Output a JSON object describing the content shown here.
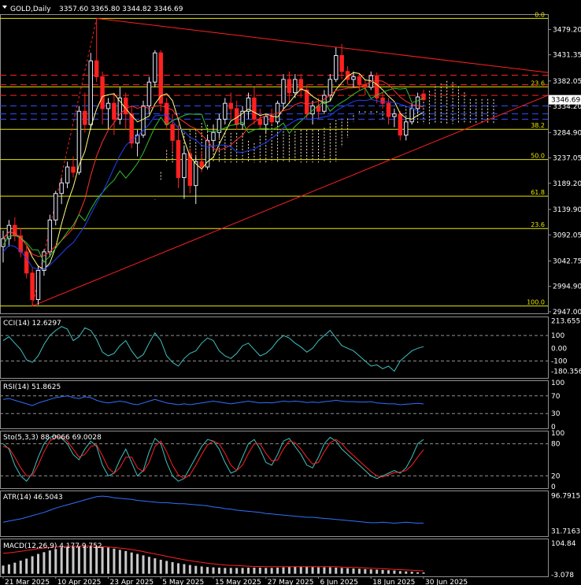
{
  "header": {
    "symbol": "GOLD,Daily",
    "ohlc": "3357.60 3365.80 3344.82 3346.69"
  },
  "colors": {
    "background": "#000000",
    "bull_candle": "#e8e8ff",
    "bear_candle": "#ff2020",
    "grid": "#808080",
    "fib": "#e8e800",
    "trend": "#ff2020",
    "ichimoku_cloud": "#ffe8c0",
    "cci": "#40c0c0",
    "rsi": "#3070ff",
    "stoch_main": "#40c0c0",
    "stoch_signal": "#ff2020",
    "atr": "#3070ff",
    "macd_hist": "#c8c8c8",
    "macd_signal": "#ff2020"
  },
  "chart_data": [
    {
      "id": "price",
      "type": "candlestick",
      "ylim": [
        2947.0,
        3505.0
      ],
      "y_ticks": [
        "3479.20",
        "3431.35",
        "3382.05",
        "3334.20",
        "3284.90",
        "3237.05",
        "3189.20",
        "3139.90",
        "3092.05",
        "3042.75",
        "2994.90",
        "2947.00"
      ],
      "current_price": "3346.69",
      "fib_levels": [
        {
          "label": "0.0",
          "value": 3500.0
        },
        {
          "label": "23.6",
          "value": 3371.0
        },
        {
          "label": "38.2",
          "value": 3291.0
        },
        {
          "label": "50.0",
          "value": 3234.0
        },
        {
          "label": "61.8",
          "value": 3165.0
        },
        {
          "label": "23.6",
          "value": 3104.0
        },
        {
          "label": "100.0",
          "value": 2958.0
        }
      ],
      "dashed_levels_red": [
        3393.0,
        3375.0,
        3355.0
      ],
      "dashed_levels_blue": [
        3335.0,
        3320.0,
        3310.0
      ],
      "candles": [
        {
          "o": 3070,
          "h": 3100,
          "l": 3040,
          "c": 3085
        },
        {
          "o": 3085,
          "h": 3120,
          "l": 3070,
          "c": 3110
        },
        {
          "o": 3110,
          "h": 3125,
          "l": 3080,
          "c": 3090
        },
        {
          "o": 3090,
          "h": 3105,
          "l": 3050,
          "c": 3060
        },
        {
          "o": 3060,
          "h": 3070,
          "l": 3010,
          "c": 3020
        },
        {
          "o": 3020,
          "h": 3030,
          "l": 2957,
          "c": 2970
        },
        {
          "o": 2970,
          "h": 3035,
          "l": 2960,
          "c": 3025
        },
        {
          "o": 3025,
          "h": 3065,
          "l": 3015,
          "c": 3060
        },
        {
          "o": 3060,
          "h": 3130,
          "l": 3050,
          "c": 3120
        },
        {
          "o": 3120,
          "h": 3175,
          "l": 3110,
          "c": 3170
        },
        {
          "o": 3170,
          "h": 3200,
          "l": 3150,
          "c": 3190
        },
        {
          "o": 3190,
          "h": 3230,
          "l": 3180,
          "c": 3220
        },
        {
          "o": 3220,
          "h": 3240,
          "l": 3200,
          "c": 3210
        },
        {
          "o": 3210,
          "h": 3335,
          "l": 3205,
          "c": 3325
        },
        {
          "o": 3325,
          "h": 3360,
          "l": 3285,
          "c": 3300
        },
        {
          "o": 3300,
          "h": 3435,
          "l": 3290,
          "c": 3420
        },
        {
          "o": 3420,
          "h": 3500,
          "l": 3380,
          "c": 3390
        },
        {
          "o": 3390,
          "h": 3400,
          "l": 3300,
          "c": 3330
        },
        {
          "o": 3330,
          "h": 3350,
          "l": 3290,
          "c": 3340
        },
        {
          "o": 3340,
          "h": 3360,
          "l": 3280,
          "c": 3310
        },
        {
          "o": 3310,
          "h": 3370,
          "l": 3300,
          "c": 3350
        },
        {
          "o": 3350,
          "h": 3360,
          "l": 3290,
          "c": 3320
        },
        {
          "o": 3320,
          "h": 3335,
          "l": 3255,
          "c": 3265
        },
        {
          "o": 3265,
          "h": 3290,
          "l": 3240,
          "c": 3280
        },
        {
          "o": 3280,
          "h": 3345,
          "l": 3275,
          "c": 3335
        },
        {
          "o": 3335,
          "h": 3390,
          "l": 3320,
          "c": 3380
        },
        {
          "o": 3380,
          "h": 3440,
          "l": 3370,
          "c": 3435
        },
        {
          "o": 3435,
          "h": 3440,
          "l": 3325,
          "c": 3340
        },
        {
          "o": 3340,
          "h": 3350,
          "l": 3290,
          "c": 3300
        },
        {
          "o": 3300,
          "h": 3320,
          "l": 3250,
          "c": 3270
        },
        {
          "o": 3270,
          "h": 3300,
          "l": 3180,
          "c": 3200
        },
        {
          "o": 3200,
          "h": 3260,
          "l": 3160,
          "c": 3245
        },
        {
          "o": 3245,
          "h": 3255,
          "l": 3170,
          "c": 3185
        },
        {
          "o": 3185,
          "h": 3240,
          "l": 3150,
          "c": 3230
        },
        {
          "o": 3230,
          "h": 3250,
          "l": 3210,
          "c": 3220
        },
        {
          "o": 3220,
          "h": 3280,
          "l": 3215,
          "c": 3270
        },
        {
          "o": 3270,
          "h": 3300,
          "l": 3250,
          "c": 3285
        },
        {
          "o": 3285,
          "h": 3320,
          "l": 3275,
          "c": 3310
        },
        {
          "o": 3310,
          "h": 3350,
          "l": 3300,
          "c": 3340
        },
        {
          "o": 3340,
          "h": 3360,
          "l": 3310,
          "c": 3330
        },
        {
          "o": 3330,
          "h": 3345,
          "l": 3290,
          "c": 3300
        },
        {
          "o": 3300,
          "h": 3335,
          "l": 3290,
          "c": 3325
        },
        {
          "o": 3325,
          "h": 3360,
          "l": 3310,
          "c": 3350
        },
        {
          "o": 3350,
          "h": 3370,
          "l": 3300,
          "c": 3310
        },
        {
          "o": 3310,
          "h": 3330,
          "l": 3290,
          "c": 3300
        },
        {
          "o": 3300,
          "h": 3320,
          "l": 3285,
          "c": 3315
        },
        {
          "o": 3315,
          "h": 3330,
          "l": 3300,
          "c": 3305
        },
        {
          "o": 3305,
          "h": 3345,
          "l": 3300,
          "c": 3340
        },
        {
          "o": 3340,
          "h": 3395,
          "l": 3330,
          "c": 3385
        },
        {
          "o": 3385,
          "h": 3400,
          "l": 3340,
          "c": 3360
        },
        {
          "o": 3360,
          "h": 3395,
          "l": 3350,
          "c": 3385
        },
        {
          "o": 3385,
          "h": 3395,
          "l": 3350,
          "c": 3365
        },
        {
          "o": 3365,
          "h": 3375,
          "l": 3310,
          "c": 3320
        },
        {
          "o": 3320,
          "h": 3345,
          "l": 3300,
          "c": 3335
        },
        {
          "o": 3335,
          "h": 3350,
          "l": 3310,
          "c": 3325
        },
        {
          "o": 3325,
          "h": 3365,
          "l": 3320,
          "c": 3355
        },
        {
          "o": 3355,
          "h": 3395,
          "l": 3345,
          "c": 3385
        },
        {
          "o": 3385,
          "h": 3445,
          "l": 3380,
          "c": 3430
        },
        {
          "o": 3430,
          "h": 3452,
          "l": 3385,
          "c": 3400
        },
        {
          "o": 3400,
          "h": 3410,
          "l": 3375,
          "c": 3385
        },
        {
          "o": 3385,
          "h": 3400,
          "l": 3370,
          "c": 3390
        },
        {
          "o": 3390,
          "h": 3395,
          "l": 3365,
          "c": 3375
        },
        {
          "o": 3375,
          "h": 3385,
          "l": 3355,
          "c": 3370
        },
        {
          "o": 3370,
          "h": 3400,
          "l": 3365,
          "c": 3392
        },
        {
          "o": 3392,
          "h": 3398,
          "l": 3340,
          "c": 3350
        },
        {
          "o": 3350,
          "h": 3360,
          "l": 3330,
          "c": 3340
        },
        {
          "o": 3340,
          "h": 3350,
          "l": 3300,
          "c": 3315
        },
        {
          "o": 3315,
          "h": 3330,
          "l": 3295,
          "c": 3320
        },
        {
          "o": 3320,
          "h": 3325,
          "l": 3270,
          "c": 3280
        },
        {
          "o": 3280,
          "h": 3310,
          "l": 3270,
          "c": 3305
        },
        {
          "o": 3305,
          "h": 3340,
          "l": 3300,
          "c": 3330
        },
        {
          "o": 3330,
          "h": 3360,
          "l": 3320,
          "c": 3352
        },
        {
          "o": 3357.6,
          "h": 3365.8,
          "l": 3344.82,
          "c": 3346.69
        }
      ]
    },
    {
      "id": "cci",
      "type": "line",
      "label": "CCI(14) 12.6297",
      "ylim": [
        -220,
        230
      ],
      "y_ticks": [
        "213.655",
        "100",
        "0.00",
        "-100",
        "-180.3566"
      ],
      "levels": [
        100,
        -100
      ],
      "values": [
        60,
        90,
        40,
        -10,
        -90,
        -110,
        -60,
        30,
        100,
        140,
        170,
        150,
        60,
        90,
        160,
        140,
        70,
        -30,
        -60,
        -40,
        20,
        60,
        -20,
        -80,
        -50,
        40,
        120,
        60,
        -60,
        -110,
        -140,
        -80,
        -40,
        -20,
        40,
        80,
        60,
        -20,
        -60,
        -80,
        -40,
        20,
        40,
        -10,
        -60,
        -40,
        0,
        60,
        100,
        80,
        40,
        10,
        -30,
        0,
        60,
        100,
        140,
        80,
        20,
        0,
        -20,
        -60,
        -100,
        -140,
        -130,
        -160,
        -140,
        -180,
        -100,
        -60,
        -20,
        0,
        12.63
      ]
    },
    {
      "id": "rsi",
      "type": "line",
      "label": "RSI(14) 51.8625",
      "ylim": [
        0,
        100
      ],
      "y_ticks": [
        "100",
        "70",
        "30",
        "0"
      ],
      "levels": [
        70,
        30
      ],
      "values": [
        62,
        64,
        60,
        56,
        52,
        48,
        54,
        58,
        62,
        66,
        68,
        70,
        66,
        64,
        68,
        66,
        60,
        56,
        54,
        56,
        58,
        56,
        52,
        50,
        54,
        58,
        62,
        58,
        54,
        52,
        50,
        52,
        50,
        52,
        54,
        56,
        58,
        56,
        54,
        52,
        54,
        56,
        58,
        56,
        54,
        55,
        54,
        56,
        58,
        57,
        58,
        57,
        55,
        56,
        55,
        57,
        58,
        60,
        58,
        57,
        57,
        56,
        56,
        57,
        54,
        53,
        52,
        52,
        50,
        51,
        52,
        53,
        51.86
      ]
    },
    {
      "id": "stoch",
      "type": "line",
      "label": "Sto(5,3,3) 88.0066 69.0028",
      "ylim": [
        0,
        100
      ],
      "y_ticks": [
        "100",
        "80",
        "20",
        "0"
      ],
      "levels": [
        80,
        20
      ],
      "series": [
        {
          "values": [
            80,
            70,
            40,
            20,
            10,
            25,
            55,
            80,
            92,
            95,
            90,
            80,
            60,
            50,
            70,
            85,
            75,
            40,
            20,
            25,
            50,
            70,
            45,
            20,
            30,
            65,
            90,
            80,
            45,
            20,
            10,
            15,
            35,
            55,
            75,
            88,
            85,
            70,
            45,
            25,
            30,
            55,
            80,
            88,
            70,
            45,
            40,
            60,
            85,
            90,
            75,
            60,
            40,
            35,
            55,
            80,
            92,
            85,
            70,
            60,
            50,
            40,
            30,
            20,
            15,
            20,
            25,
            30,
            25,
            35,
            55,
            80,
            88.01
          ]
        },
        {
          "values": [
            75,
            72,
            55,
            35,
            20,
            20,
            40,
            65,
            85,
            92,
            92,
            85,
            70,
            55,
            60,
            75,
            78,
            58,
            35,
            25,
            35,
            55,
            55,
            35,
            28,
            45,
            75,
            85,
            65,
            40,
            22,
            15,
            22,
            40,
            60,
            78,
            85,
            80,
            62,
            40,
            30,
            40,
            62,
            80,
            80,
            62,
            48,
            50,
            70,
            85,
            82,
            70,
            55,
            42,
            45,
            65,
            82,
            88,
            80,
            68,
            58,
            48,
            38,
            28,
            20,
            18,
            22,
            26,
            27,
            30,
            40,
            55,
            69.0
          ]
        }
      ]
    },
    {
      "id": "atr",
      "type": "line",
      "label": "ATR(14) 46.5043",
      "ylim": [
        25,
        102
      ],
      "y_ticks": [
        "96.7915",
        "31.7163"
      ],
      "values": [
        48,
        50,
        52,
        54,
        57,
        60,
        63,
        66,
        70,
        74,
        77,
        80,
        83,
        86,
        89,
        92,
        95,
        96,
        95,
        93,
        92,
        91,
        90,
        88,
        87,
        86,
        85,
        84,
        84,
        83,
        82,
        82,
        81,
        80,
        79,
        78,
        76,
        75,
        73,
        72,
        70,
        69,
        68,
        67,
        66,
        64,
        63,
        62,
        61,
        60,
        59,
        58,
        57,
        57,
        56,
        55,
        54,
        53,
        52,
        51,
        50,
        49,
        48,
        47,
        47,
        48,
        47,
        46,
        47,
        48,
        47,
        46,
        46.5
      ]
    },
    {
      "id": "macd",
      "type": "bar",
      "label": "MACD(12,26,9) 4.177 9.752",
      "ylim": [
        -3.5,
        110
      ],
      "y_ticks": [
        "104.84",
        "-3.078"
      ],
      "histogram": [
        28,
        32,
        38,
        45,
        52,
        60,
        68,
        74,
        80,
        85,
        90,
        92,
        93,
        95,
        96,
        95,
        94,
        93,
        90,
        86,
        82,
        78,
        73,
        68,
        63,
        58,
        53,
        48,
        44,
        40,
        36,
        33,
        30,
        27,
        25,
        23,
        22,
        21,
        20,
        20,
        20,
        20,
        21,
        21,
        21,
        20,
        20,
        21,
        22,
        23,
        24,
        25,
        24,
        23,
        22,
        22,
        22,
        21,
        20,
        19,
        18,
        17,
        16,
        15,
        14,
        13,
        12,
        11,
        9,
        8,
        7,
        5,
        4.18
      ],
      "signal": [
        70,
        72,
        74,
        77,
        80,
        83,
        86,
        88,
        90,
        92,
        93,
        94,
        94,
        95,
        95,
        95,
        94,
        93,
        92,
        90,
        88,
        86,
        83,
        80,
        76,
        72,
        68,
        64,
        60,
        56,
        52,
        48,
        45,
        42,
        39,
        36,
        34,
        32,
        30,
        29,
        28,
        27,
        26,
        25,
        25,
        24,
        24,
        24,
        24,
        24,
        24,
        24,
        24,
        24,
        24,
        24,
        24,
        24,
        23,
        22,
        22,
        21,
        20,
        19,
        18,
        17,
        16,
        15,
        14,
        13,
        12,
        11,
        9.75
      ]
    }
  ],
  "x_axis": {
    "labels": [
      "21 Mar 2025",
      "10 Apr 2025",
      "23 Apr 2025",
      "5 May 2025",
      "15 May 2025",
      "27 May 2025",
      "6 Jun 2025",
      "18 Jun 2025",
      "30 Jun 2025"
    ]
  }
}
